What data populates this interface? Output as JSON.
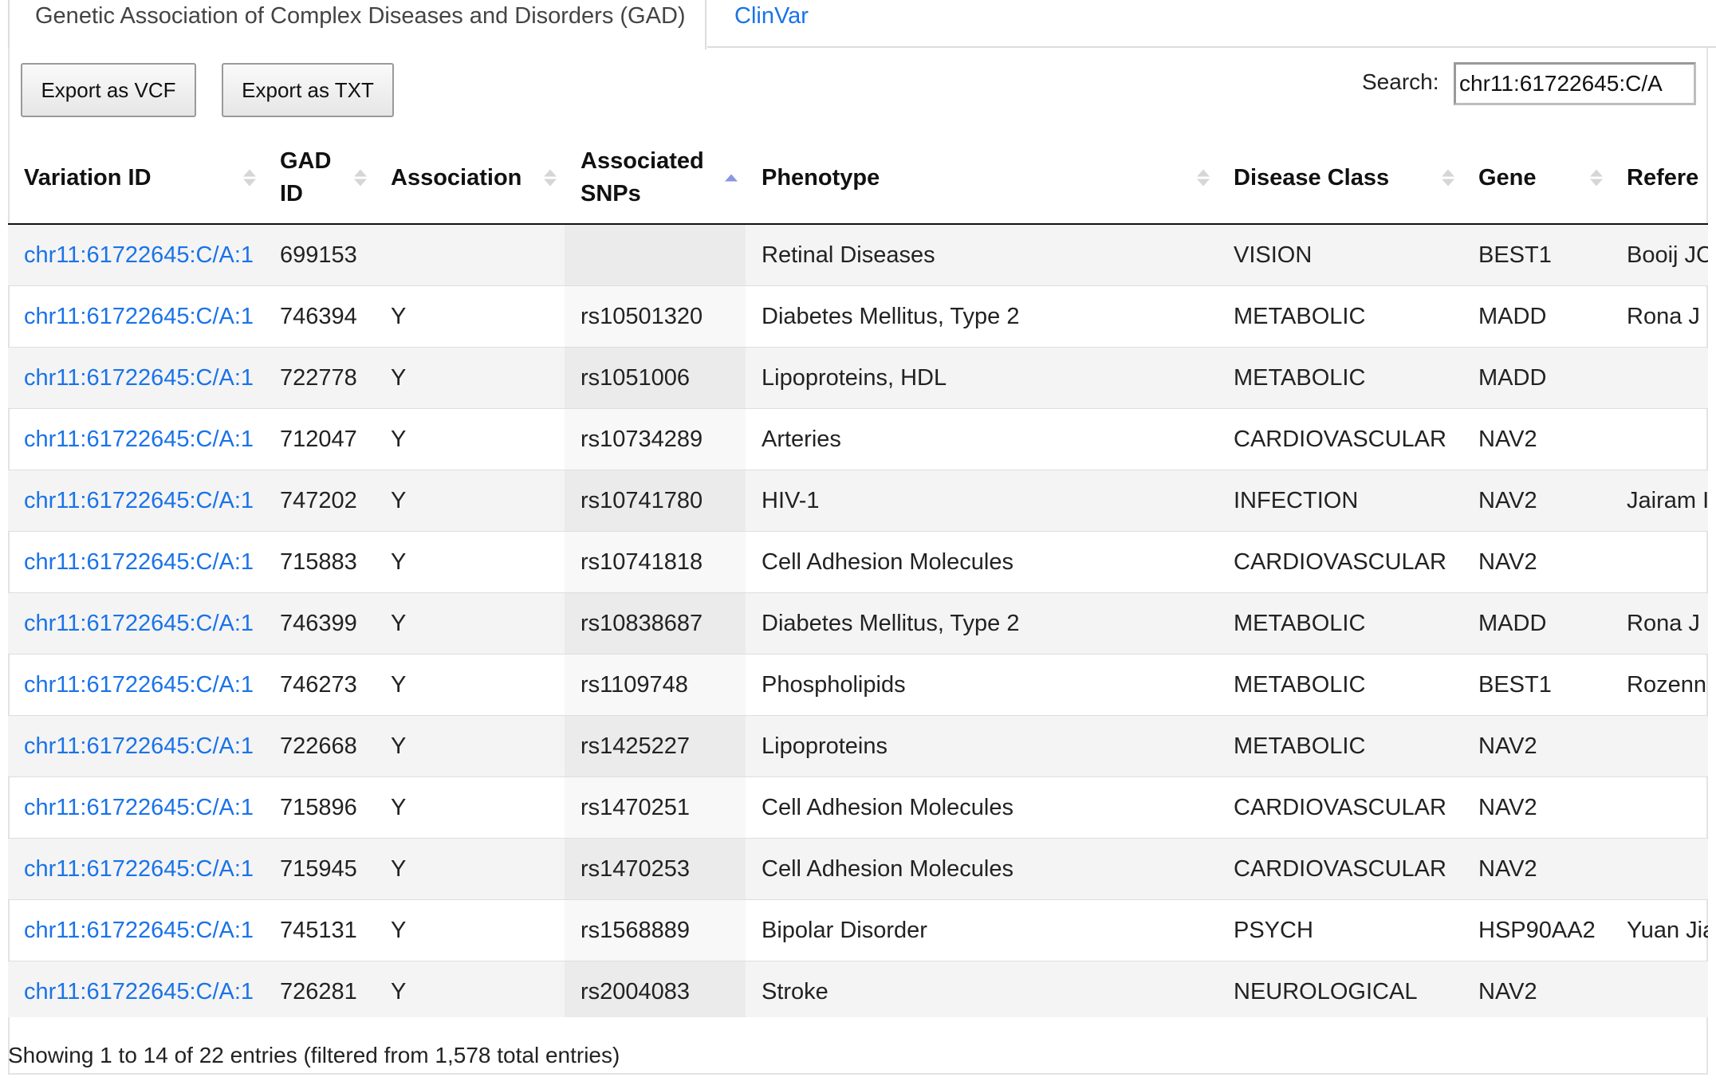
{
  "tabs": {
    "active": "Genetic Association of Complex Diseases and Disorders (GAD)",
    "other": "ClinVar"
  },
  "toolbar": {
    "export_vcf": "Export as VCF",
    "export_txt": "Export as TXT",
    "search_label": "Search:",
    "search_value": "chr11:61722645:C/A"
  },
  "table": {
    "sorted_column": "Associated SNPs",
    "sort_direction": "ascending",
    "columns": [
      {
        "line1": "Variation ID",
        "line2": ""
      },
      {
        "line1": "GAD",
        "line2": "ID"
      },
      {
        "line1": "Association",
        "line2": ""
      },
      {
        "line1": "Associated",
        "line2": "SNPs"
      },
      {
        "line1": "Phenotype",
        "line2": ""
      },
      {
        "line1": "Disease Class",
        "line2": ""
      },
      {
        "line1": "Gene",
        "line2": ""
      },
      {
        "line1": "Refere",
        "line2": ""
      }
    ],
    "rows": [
      [
        "chr11:61722645:C/A:1",
        "699153",
        "",
        "",
        "Retinal Diseases",
        "VISION",
        "BEST1",
        "Booij JC"
      ],
      [
        "chr11:61722645:C/A:1",
        "746394",
        "Y",
        "rs10501320",
        "Diabetes Mellitus, Type 2",
        "METABOLIC",
        "MADD",
        "Rona J"
      ],
      [
        "chr11:61722645:C/A:1",
        "722778",
        "Y",
        "rs1051006",
        "Lipoproteins, HDL",
        "METABOLIC",
        "MADD",
        ""
      ],
      [
        "chr11:61722645:C/A:1",
        "712047",
        "Y",
        "rs10734289",
        "Arteries",
        "CARDIOVASCULAR",
        "NAV2",
        ""
      ],
      [
        "chr11:61722645:C/A:1",
        "747202",
        "Y",
        "rs10741780",
        "HIV-1",
        "INFECTION",
        "NAV2",
        "Jairam I"
      ],
      [
        "chr11:61722645:C/A:1",
        "715883",
        "Y",
        "rs10741818",
        "Cell Adhesion Molecules",
        "CARDIOVASCULAR",
        "NAV2",
        ""
      ],
      [
        "chr11:61722645:C/A:1",
        "746399",
        "Y",
        "rs10838687",
        "Diabetes Mellitus, Type 2",
        "METABOLIC",
        "MADD",
        "Rona J"
      ],
      [
        "chr11:61722645:C/A:1",
        "746273",
        "Y",
        "rs1109748",
        "Phospholipids",
        "METABOLIC",
        "BEST1",
        "Rozenn"
      ],
      [
        "chr11:61722645:C/A:1",
        "722668",
        "Y",
        "rs1425227",
        "Lipoproteins",
        "METABOLIC",
        "NAV2",
        ""
      ],
      [
        "chr11:61722645:C/A:1",
        "715896",
        "Y",
        "rs1470251",
        "Cell Adhesion Molecules",
        "CARDIOVASCULAR",
        "NAV2",
        ""
      ],
      [
        "chr11:61722645:C/A:1",
        "715945",
        "Y",
        "rs1470253",
        "Cell Adhesion Molecules",
        "CARDIOVASCULAR",
        "NAV2",
        ""
      ],
      [
        "chr11:61722645:C/A:1",
        "745131",
        "Y",
        "rs1568889",
        "Bipolar Disorder",
        "PSYCH",
        "HSP90AA2",
        "Yuan Jia"
      ],
      [
        "chr11:61722645:C/A:1",
        "726281",
        "Y",
        "rs2004083",
        "Stroke",
        "NEUROLOGICAL",
        "NAV2",
        ""
      ]
    ]
  },
  "footer": {
    "info": "Showing 1 to 14 of 22 entries (filtered from 1,578 total entries)"
  },
  "colors": {
    "link": "#1a73e8",
    "sort_active": "#8b96e0"
  }
}
